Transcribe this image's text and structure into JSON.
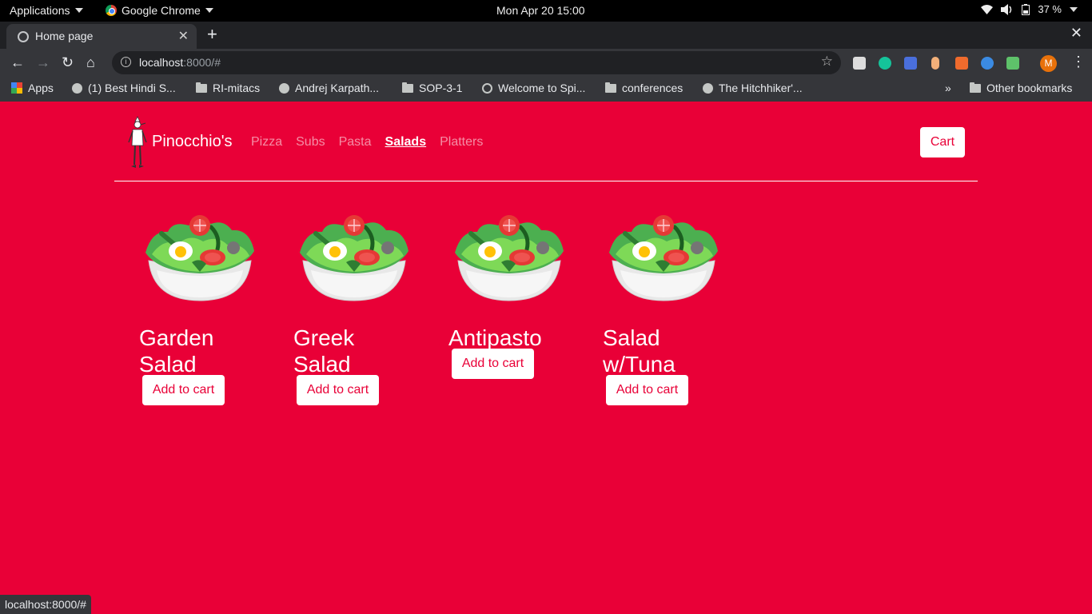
{
  "system": {
    "apps_menu": "Applications",
    "active_app": "Google Chrome",
    "clock": "Mon Apr 20  15:00",
    "battery": "37 %"
  },
  "browser": {
    "tab_title": "Home page",
    "url_host": "localhost",
    "url_rest": ":8000/#",
    "bookmarks": [
      {
        "label": "Apps",
        "icon": "apps-grid-icon"
      },
      {
        "label": "(1) Best Hindi S...",
        "icon": "globe-icon"
      },
      {
        "label": "RI-mitacs",
        "icon": "folder-icon"
      },
      {
        "label": "Andrej Karpath...",
        "icon": "globe-icon"
      },
      {
        "label": "SOP-3-1",
        "icon": "folder-icon"
      },
      {
        "label": "Welcome to Spi...",
        "icon": "openai-icon"
      },
      {
        "label": "conferences",
        "icon": "folder-icon"
      },
      {
        "label": "The Hitchhiker'...",
        "icon": "globe-icon"
      }
    ],
    "overflow": "»",
    "other_bookmarks": "Other bookmarks",
    "profile_initial": "M",
    "status_url": "localhost:8000/#"
  },
  "site": {
    "brand": "Pinocchio's",
    "nav": [
      {
        "label": "Pizza",
        "active": false
      },
      {
        "label": "Subs",
        "active": false
      },
      {
        "label": "Pasta",
        "active": false
      },
      {
        "label": "Salads",
        "active": true
      },
      {
        "label": "Platters",
        "active": false
      }
    ],
    "cart_label": "Cart",
    "add_label": "Add to cart",
    "items": [
      {
        "name": "Garden Salad"
      },
      {
        "name": "Greek Salad"
      },
      {
        "name": "Antipasto"
      },
      {
        "name": "Salad w/Tuna"
      }
    ]
  },
  "colors": {
    "page_bg": "#e90037",
    "button_bg": "#ffffff",
    "button_text": "#e90037"
  }
}
